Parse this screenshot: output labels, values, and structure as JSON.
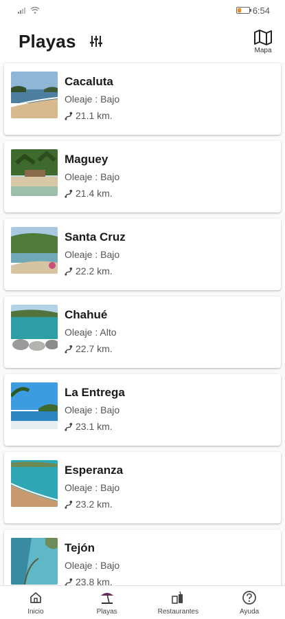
{
  "status_bar": {
    "time": "6:54",
    "battery_level": 0.3,
    "battery_color": "#f08a24"
  },
  "header": {
    "title": "Playas",
    "filter_icon": "sliders-icon",
    "map_label": "Mapa",
    "map_icon": "map-icon"
  },
  "waves_label": "Oleaje :",
  "beaches": [
    {
      "name": "Cacaluta",
      "waves": "Bajo",
      "distance": "21.1 km."
    },
    {
      "name": "Maguey",
      "waves": "Bajo",
      "distance": "21.4 km."
    },
    {
      "name": "Santa Cruz",
      "waves": "Bajo",
      "distance": "22.2 km."
    },
    {
      "name": "Chahué",
      "waves": "Alto",
      "distance": "22.7 km."
    },
    {
      "name": "La Entrega",
      "waves": "Bajo",
      "distance": "23.1 km."
    },
    {
      "name": "Esperanza",
      "waves": "Bajo",
      "distance": "23.2 km."
    },
    {
      "name": "Tejón",
      "waves": "Bajo",
      "distance": "23.8 km."
    }
  ],
  "nav": [
    {
      "label": "Inicio",
      "icon": "home-icon"
    },
    {
      "label": "Playas",
      "icon": "beach-umbrella-icon",
      "accent": "#6b2a5c"
    },
    {
      "label": "Restaurantes",
      "icon": "restaurant-icon"
    },
    {
      "label": "Ayuda",
      "icon": "help-icon"
    }
  ]
}
